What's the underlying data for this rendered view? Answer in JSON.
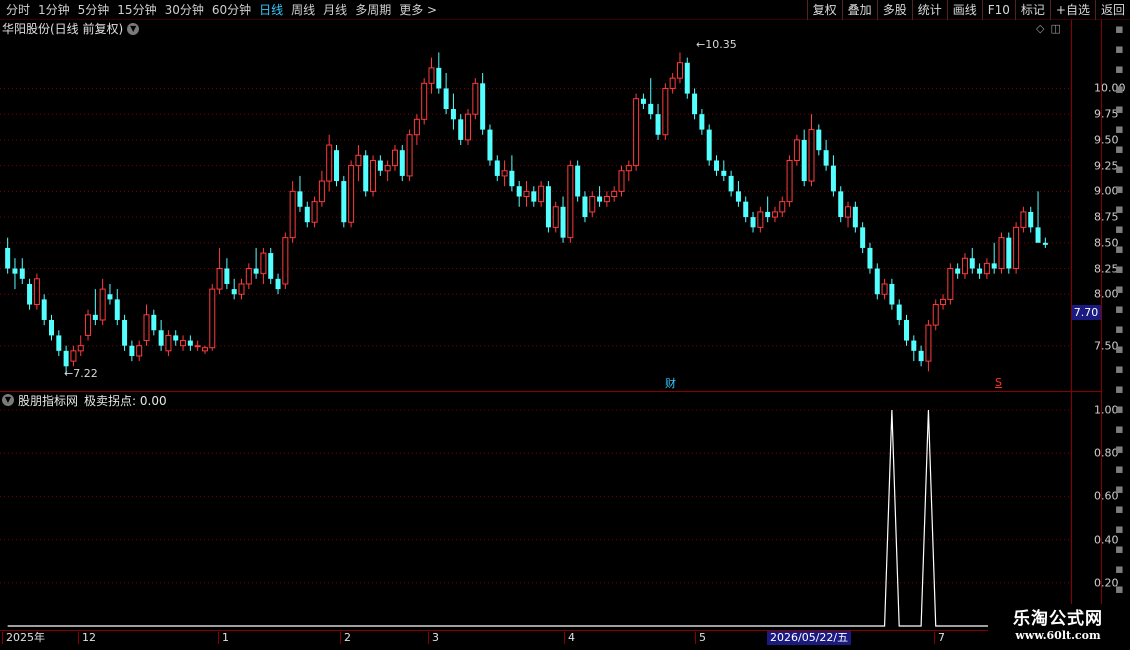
{
  "toolbar": {
    "periods": [
      "分时",
      "1分钟",
      "5分钟",
      "15分钟",
      "30分钟",
      "60分钟",
      "日线",
      "周线",
      "月线",
      "多周期",
      "更多 >"
    ],
    "active_period": "日线",
    "buttons": [
      "复权",
      "叠加",
      "多股",
      "统计",
      "画线",
      "F10",
      "标记",
      "+自选",
      "返回"
    ]
  },
  "main_chart": {
    "title": "华阳股份(日线 前复权)",
    "price_ticks": [
      "10.00",
      "9.75",
      "9.50",
      "9.25",
      "9.00",
      "8.75",
      "8.50",
      "8.25",
      "8.00",
      "7.50"
    ],
    "current_price": "7.70",
    "high_annotation": "10.35",
    "low_annotation": "7.22",
    "event_marker": "财",
    "signal_marker": "S"
  },
  "indicator": {
    "name": "股朋指标网",
    "value_label": "极卖拐点: 0.00",
    "ticks": [
      "1.00",
      "0.80",
      "0.60",
      "0.40",
      "0.20"
    ]
  },
  "x_axis": {
    "labels": [
      "2025年",
      "12",
      "1",
      "2",
      "3",
      "4",
      "5",
      "7"
    ],
    "cursor_date": "2026/05/22/五"
  },
  "watermark": {
    "title": "乐淘公式网",
    "url": "www.60lt.com"
  },
  "colors": {
    "up": "#ff3b3b",
    "down": "#54ffff",
    "grid": "#7a0000",
    "axis": "#8a0000",
    "active": "#36c8ff"
  },
  "chart_data": {
    "type": "candlestick",
    "ylim": [
      7.05,
      10.5
    ],
    "candles": [
      [
        8.45,
        8.55,
        8.2,
        8.25
      ],
      [
        8.25,
        8.35,
        8.05,
        8.2
      ],
      [
        8.25,
        8.35,
        8.1,
        8.15
      ],
      [
        8.1,
        8.15,
        7.85,
        7.9
      ],
      [
        7.9,
        8.2,
        7.85,
        8.15
      ],
      [
        7.95,
        8.0,
        7.7,
        7.75
      ],
      [
        7.75,
        7.8,
        7.55,
        7.6
      ],
      [
        7.6,
        7.65,
        7.4,
        7.45
      ],
      [
        7.45,
        7.5,
        7.22,
        7.3
      ],
      [
        7.35,
        7.5,
        7.3,
        7.45
      ],
      [
        7.45,
        7.6,
        7.4,
        7.5
      ],
      [
        7.6,
        7.85,
        7.55,
        7.8
      ],
      [
        7.8,
        8.05,
        7.7,
        7.75
      ],
      [
        7.75,
        8.15,
        7.7,
        8.05
      ],
      [
        8.0,
        8.1,
        7.9,
        7.95
      ],
      [
        7.95,
        8.05,
        7.7,
        7.75
      ],
      [
        7.75,
        7.8,
        7.45,
        7.5
      ],
      [
        7.5,
        7.55,
        7.35,
        7.4
      ],
      [
        7.4,
        7.55,
        7.35,
        7.5
      ],
      [
        7.55,
        7.9,
        7.5,
        7.8
      ],
      [
        7.8,
        7.85,
        7.6,
        7.65
      ],
      [
        7.65,
        7.75,
        7.45,
        7.5
      ],
      [
        7.45,
        7.65,
        7.4,
        7.6
      ],
      [
        7.6,
        7.65,
        7.5,
        7.55
      ],
      [
        7.5,
        7.6,
        7.45,
        7.55
      ],
      [
        7.55,
        7.6,
        7.45,
        7.5
      ],
      [
        7.5,
        7.55,
        7.45,
        7.5
      ],
      [
        7.45,
        7.5,
        7.42,
        7.48
      ],
      [
        7.48,
        8.1,
        7.45,
        8.05
      ],
      [
        8.05,
        8.45,
        8.0,
        8.25
      ],
      [
        8.25,
        8.35,
        8.05,
        8.1
      ],
      [
        8.05,
        8.15,
        7.95,
        8.0
      ],
      [
        8.0,
        8.15,
        7.95,
        8.1
      ],
      [
        8.1,
        8.3,
        8.05,
        8.25
      ],
      [
        8.25,
        8.45,
        8.15,
        8.2
      ],
      [
        8.2,
        8.45,
        8.1,
        8.4
      ],
      [
        8.4,
        8.45,
        8.1,
        8.15
      ],
      [
        8.15,
        8.2,
        8.0,
        8.05
      ],
      [
        8.1,
        8.6,
        8.05,
        8.55
      ],
      [
        8.55,
        9.1,
        8.5,
        9.0
      ],
      [
        9.0,
        9.15,
        8.8,
        8.85
      ],
      [
        8.85,
        8.9,
        8.65,
        8.7
      ],
      [
        8.7,
        8.95,
        8.65,
        8.9
      ],
      [
        8.9,
        9.2,
        8.85,
        9.1
      ],
      [
        9.1,
        9.55,
        9.0,
        9.45
      ],
      [
        9.4,
        9.45,
        9.05,
        9.1
      ],
      [
        9.1,
        9.15,
        8.65,
        8.7
      ],
      [
        8.7,
        9.3,
        8.65,
        9.25
      ],
      [
        9.25,
        9.45,
        9.1,
        9.35
      ],
      [
        9.35,
        9.4,
        8.95,
        9.0
      ],
      [
        9.0,
        9.35,
        8.95,
        9.3
      ],
      [
        9.3,
        9.35,
        9.15,
        9.2
      ],
      [
        9.2,
        9.3,
        9.1,
        9.25
      ],
      [
        9.25,
        9.45,
        9.2,
        9.4
      ],
      [
        9.4,
        9.45,
        9.1,
        9.15
      ],
      [
        9.15,
        9.6,
        9.1,
        9.55
      ],
      [
        9.55,
        9.75,
        9.45,
        9.7
      ],
      [
        9.7,
        10.1,
        9.65,
        10.05
      ],
      [
        10.05,
        10.3,
        9.95,
        10.2
      ],
      [
        10.2,
        10.35,
        9.95,
        10.0
      ],
      [
        10.0,
        10.15,
        9.75,
        9.8
      ],
      [
        9.8,
        9.95,
        9.6,
        9.7
      ],
      [
        9.7,
        9.75,
        9.45,
        9.5
      ],
      [
        9.5,
        9.8,
        9.45,
        9.75
      ],
      [
        9.75,
        10.1,
        9.7,
        10.05
      ],
      [
        10.05,
        10.15,
        9.55,
        9.6
      ],
      [
        9.6,
        9.65,
        9.25,
        9.3
      ],
      [
        9.3,
        9.35,
        9.1,
        9.15
      ],
      [
        9.15,
        9.3,
        9.05,
        9.2
      ],
      [
        9.2,
        9.35,
        9.0,
        9.05
      ],
      [
        9.05,
        9.1,
        8.85,
        8.95
      ],
      [
        8.95,
        9.1,
        8.85,
        9.0
      ],
      [
        9.0,
        9.05,
        8.85,
        8.9
      ],
      [
        8.9,
        9.1,
        8.85,
        9.05
      ],
      [
        9.05,
        9.1,
        8.6,
        8.65
      ],
      [
        8.65,
        8.9,
        8.6,
        8.85
      ],
      [
        8.85,
        8.95,
        8.5,
        8.55
      ],
      [
        8.55,
        9.3,
        8.5,
        9.25
      ],
      [
        9.25,
        9.3,
        8.9,
        8.95
      ],
      [
        8.95,
        9.0,
        8.7,
        8.75
      ],
      [
        8.8,
        9.0,
        8.75,
        8.95
      ],
      [
        8.95,
        9.05,
        8.85,
        8.9
      ],
      [
        8.9,
        9.0,
        8.85,
        8.95
      ],
      [
        8.95,
        9.05,
        8.9,
        9.0
      ],
      [
        9.0,
        9.25,
        8.95,
        9.2
      ],
      [
        9.2,
        9.3,
        9.1,
        9.25
      ],
      [
        9.25,
        9.95,
        9.2,
        9.9
      ],
      [
        9.9,
        9.95,
        9.8,
        9.85
      ],
      [
        9.85,
        10.1,
        9.7,
        9.75
      ],
      [
        9.75,
        9.85,
        9.5,
        9.55
      ],
      [
        9.55,
        10.05,
        9.5,
        10.0
      ],
      [
        10.0,
        10.15,
        9.95,
        10.1
      ],
      [
        10.1,
        10.35,
        10.05,
        10.25
      ],
      [
        10.25,
        10.3,
        9.9,
        9.95
      ],
      [
        9.95,
        10.0,
        9.7,
        9.75
      ],
      [
        9.75,
        9.8,
        9.55,
        9.6
      ],
      [
        9.6,
        9.65,
        9.25,
        9.3
      ],
      [
        9.3,
        9.35,
        9.15,
        9.2
      ],
      [
        9.2,
        9.3,
        9.1,
        9.15
      ],
      [
        9.15,
        9.2,
        8.95,
        9.0
      ],
      [
        9.0,
        9.1,
        8.85,
        8.9
      ],
      [
        8.9,
        8.95,
        8.7,
        8.75
      ],
      [
        8.75,
        8.8,
        8.6,
        8.65
      ],
      [
        8.65,
        8.85,
        8.6,
        8.8
      ],
      [
        8.8,
        8.95,
        8.7,
        8.75
      ],
      [
        8.75,
        8.85,
        8.7,
        8.8
      ],
      [
        8.8,
        8.95,
        8.75,
        8.9
      ],
      [
        8.9,
        9.35,
        8.85,
        9.3
      ],
      [
        9.3,
        9.55,
        9.25,
        9.5
      ],
      [
        9.5,
        9.6,
        9.05,
        9.1
      ],
      [
        9.1,
        9.75,
        9.05,
        9.6
      ],
      [
        9.6,
        9.65,
        9.35,
        9.4
      ],
      [
        9.4,
        9.5,
        9.2,
        9.25
      ],
      [
        9.25,
        9.35,
        8.95,
        9.0
      ],
      [
        9.0,
        9.05,
        8.7,
        8.75
      ],
      [
        8.75,
        8.9,
        8.65,
        8.85
      ],
      [
        8.85,
        8.9,
        8.6,
        8.65
      ],
      [
        8.65,
        8.7,
        8.4,
        8.45
      ],
      [
        8.45,
        8.5,
        8.2,
        8.25
      ],
      [
        8.25,
        8.3,
        7.95,
        8.0
      ],
      [
        8.0,
        8.15,
        7.95,
        8.1
      ],
      [
        8.1,
        8.15,
        7.85,
        7.9
      ],
      [
        7.9,
        7.95,
        7.7,
        7.75
      ],
      [
        7.75,
        7.8,
        7.5,
        7.55
      ],
      [
        7.55,
        7.6,
        7.35,
        7.45
      ],
      [
        7.45,
        7.5,
        7.3,
        7.35
      ],
      [
        7.35,
        7.75,
        7.25,
        7.7
      ],
      [
        7.7,
        7.95,
        7.65,
        7.9
      ],
      [
        7.9,
        8.0,
        7.85,
        7.95
      ],
      [
        7.95,
        8.3,
        7.9,
        8.25
      ],
      [
        8.25,
        8.3,
        8.15,
        8.2
      ],
      [
        8.2,
        8.4,
        8.15,
        8.35
      ],
      [
        8.35,
        8.45,
        8.2,
        8.25
      ],
      [
        8.25,
        8.3,
        8.15,
        8.2
      ],
      [
        8.2,
        8.35,
        8.15,
        8.3
      ],
      [
        8.3,
        8.5,
        8.2,
        8.25
      ],
      [
        8.25,
        8.6,
        8.2,
        8.55
      ],
      [
        8.55,
        8.6,
        8.2,
        8.25
      ],
      [
        8.25,
        8.7,
        8.2,
        8.65
      ],
      [
        8.65,
        8.85,
        8.6,
        8.8
      ],
      [
        8.8,
        8.85,
        8.6,
        8.65
      ],
      [
        8.65,
        9.0,
        8.55,
        8.5
      ],
      [
        8.5,
        8.55,
        8.45,
        8.48
      ]
    ],
    "indicator_series": {
      "name": "极卖拐点",
      "peaks_at_index": [
        121,
        126
      ]
    }
  }
}
